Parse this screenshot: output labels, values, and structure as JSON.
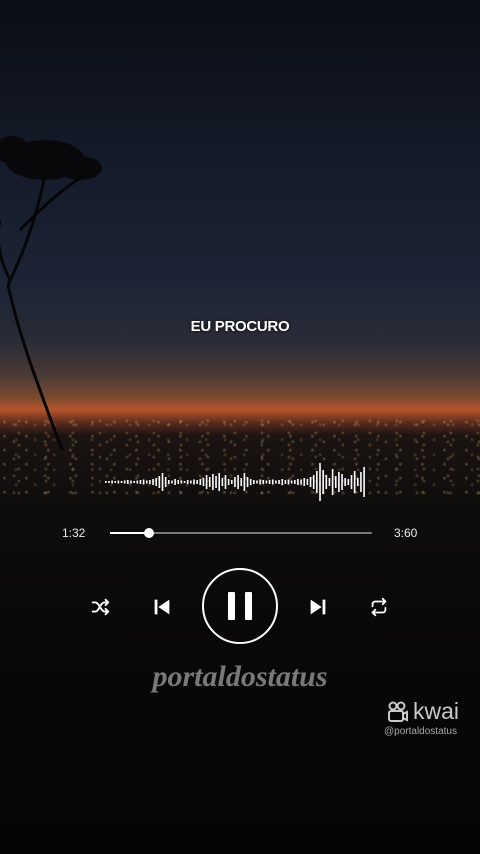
{
  "lyric": "EU PROCURO",
  "player": {
    "time_elapsed": "1:32",
    "time_total": "3:60",
    "progress": 0.15,
    "state": "playing"
  },
  "controls": {
    "shuffle_icon": "shuffle-icon",
    "previous_icon": "skip-previous-icon",
    "pause_icon": "pause-icon",
    "next_icon": "skip-next-icon",
    "repeat_icon": "repeat-icon"
  },
  "watermark": "portaldostatus",
  "kwai": {
    "brand": "kwai",
    "handle": "@portaldostatus"
  },
  "colors": {
    "accent": "#ffffff",
    "sky_glow": "#b4552a"
  }
}
